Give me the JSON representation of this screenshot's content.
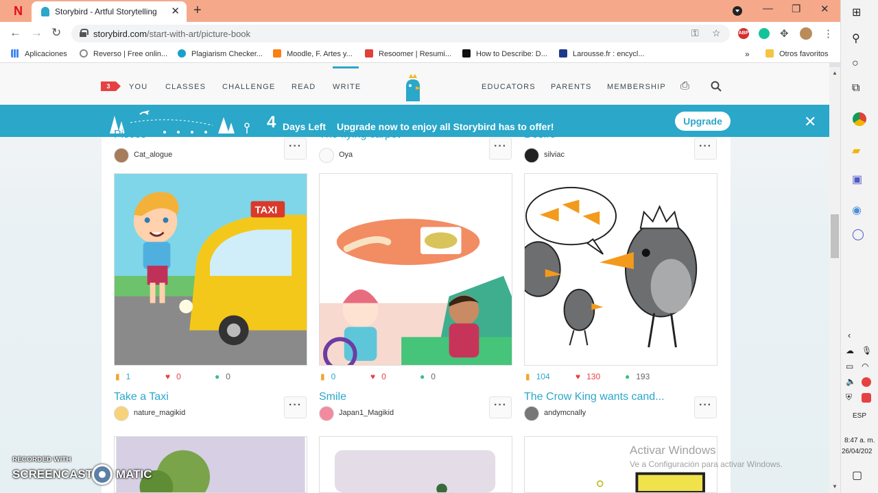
{
  "browser": {
    "tab_title": "Storybird - Artful Storytelling",
    "url_domain": "storybird.com",
    "url_path": "/start-with-art/picture-book",
    "bookmarks": [
      "Aplicaciones",
      "Reverso | Free onlin...",
      "Plagiarism Checker...",
      "Moodle, F. Artes y...",
      "Resoomer | Resumi...",
      "How to Describe: D...",
      "Larousse.fr : encycl..."
    ],
    "other_bookmarks": "Otros favoritos",
    "ext_abp": "ABP"
  },
  "site": {
    "notification_count": "3",
    "nav_left": [
      "YOU",
      "CLASSES",
      "CHALLENGE",
      "READ",
      "WRITE"
    ],
    "nav_right": [
      "EDUCATORS",
      "PARENTS",
      "MEMBERSHIP"
    ],
    "active_nav": "WRITE"
  },
  "banner": {
    "days_number": "4",
    "days_label": "Days Left",
    "message": "Upgrade now to enjoy all Storybird has to offer!",
    "upgrade_label": "Upgrade"
  },
  "cards_top": [
    {
      "title": "Pisces",
      "author": "Cat_alogue"
    },
    {
      "title": "The flying carpet",
      "author": "Oya"
    },
    {
      "title": "Desire",
      "author": "silviac"
    }
  ],
  "cards": [
    {
      "title": "Take a Taxi",
      "author": "nature_magikid",
      "reads": "1",
      "likes": "0",
      "comments": "0",
      "taxi_sign": "TAXI"
    },
    {
      "title": "Smile",
      "author": "Japan1_Magikid",
      "reads": "0",
      "likes": "0",
      "comments": "0"
    },
    {
      "title": "The Crow King wants cand...",
      "author": "andymcnally",
      "reads": "104",
      "likes": "130",
      "comments": "193"
    }
  ],
  "more_label": "···",
  "watermark": {
    "title": "Activar Windows",
    "subtitle": "Ve a Configuración para activar Windows."
  },
  "screencast": {
    "top": "RECORDED WITH",
    "left": "SCREENCAST",
    "right": "MATIC"
  },
  "taskbar": {
    "lang": "ESP",
    "time": "8:47 a. m.",
    "date": "26/04/202"
  },
  "colors": {
    "brand": "#2aa7c9",
    "like": "#e64142",
    "read": "#f0a530",
    "comment": "#37c280"
  }
}
